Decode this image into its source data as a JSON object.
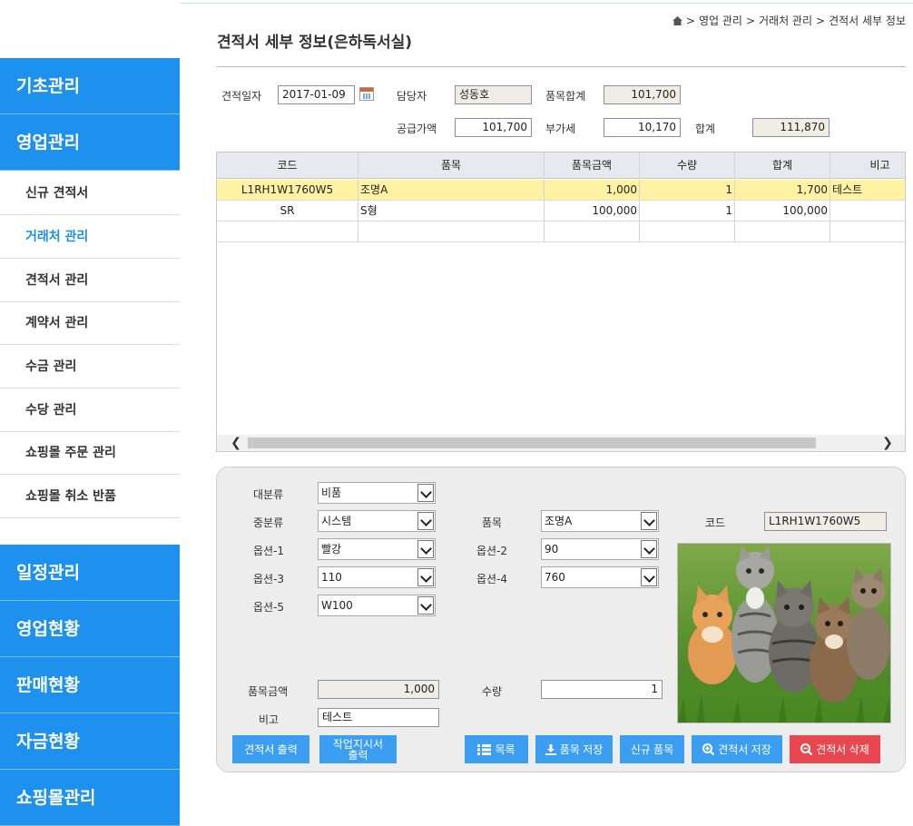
{
  "breadcrumb": {
    "items": [
      "영업 관리",
      "거래처 관리",
      "견적서 세부 정보"
    ]
  },
  "page": {
    "title": "견적서 세부 정보(은하독서실)"
  },
  "sidebar": {
    "top_groups": [
      "기초관리",
      "영업관리"
    ],
    "sub_items": [
      "신규 견적서",
      "거래처 관리",
      "견적서 관리",
      "계약서 관리",
      "수금 관리",
      "수당 관리",
      "쇼핑몰 주문 관리",
      "쇼핑몰 취소 반품"
    ],
    "active_sub": "거래처 관리",
    "bottom_groups": [
      "일정관리",
      "영업현황",
      "판매현황",
      "자금현황",
      "쇼핑몰관리"
    ]
  },
  "form": {
    "date_label": "견적일자",
    "date_value": "2017-01-09",
    "manager_label": "담당자",
    "manager_value": "성동호",
    "item_total_label": "품목합계",
    "item_total_value": "101,700",
    "supply_label": "공급가액",
    "supply_value": "101,700",
    "vat_label": "부가세",
    "vat_value": "10,170",
    "sum_label": "합계",
    "sum_value": "111,870"
  },
  "grid": {
    "columns": [
      "코드",
      "품목",
      "품목금액",
      "수량",
      "합계",
      "비고"
    ],
    "rows": [
      [
        "L1RH1W1760W5",
        "조명A",
        "1,000",
        "1",
        "1,700",
        "테스트"
      ],
      [
        "SR",
        "S형",
        "100,000",
        "1",
        "100,000",
        ""
      ],
      [
        "",
        "",
        "",
        "",
        "",
        ""
      ]
    ],
    "selected_row": 0
  },
  "detail": {
    "major_label": "대분류",
    "major_value": "비품",
    "minor_label": "중분류",
    "minor_value": "시스템",
    "item_label": "품목",
    "item_value": "조명A",
    "code_label": "코드",
    "code_value": "L1RH1W1760W5",
    "opt1_label": "옵션-1",
    "opt1_value": "빨강",
    "opt2_label": "옵션-2",
    "opt2_value": "90",
    "opt3_label": "옵션-3",
    "opt3_value": "110",
    "opt4_label": "옵션-4",
    "opt4_value": "760",
    "opt5_label": "옵션-5",
    "opt5_value": "W100",
    "price_label": "품목금액",
    "price_value": "1,000",
    "qty_label": "수량",
    "qty_value": "1",
    "note_label": "비고",
    "note_value": "테스트"
  },
  "buttons": {
    "print_quote": "견적서 출력",
    "print_work_1": "작업지시서",
    "print_work_2": "출력",
    "list": "목록",
    "save_item": "품목 저장",
    "new_item": "신규 품목",
    "save_quote": "견적서 저장",
    "delete_quote": "견적서 삭제"
  },
  "colors": {
    "accent": "#1e90ee",
    "button": "#3c9ef0",
    "danger": "#e8474f",
    "selected_row": "#fff3a3"
  }
}
